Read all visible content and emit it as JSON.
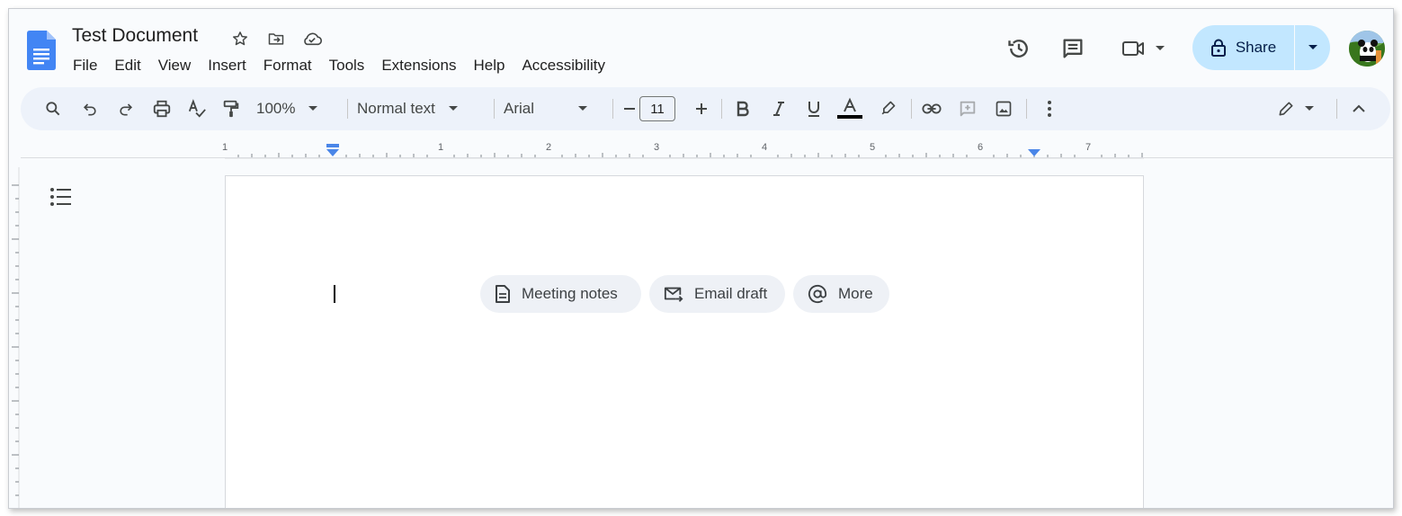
{
  "document": {
    "title": "Test Document"
  },
  "menu": {
    "items": [
      "File",
      "Edit",
      "View",
      "Insert",
      "Format",
      "Tools",
      "Extensions",
      "Help",
      "Accessibility"
    ]
  },
  "header": {
    "share_label": "Share"
  },
  "toolbar": {
    "zoom": "100%",
    "style": "Normal text",
    "font": "Arial",
    "font_size": "11",
    "text_color": "#000000"
  },
  "ruler": {
    "labels": [
      "1",
      "1",
      "2",
      "3",
      "4",
      "5",
      "6",
      "7"
    ]
  },
  "chips": {
    "meeting_notes": "Meeting notes",
    "email_draft": "Email draft",
    "more": "More"
  },
  "icons": {
    "doc": "google-docs-icon",
    "star": "star-icon",
    "move": "move-to-folder-icon",
    "cloud": "cloud-saved-icon",
    "history": "version-history-icon",
    "comments": "comments-icon",
    "meet": "video-call-icon",
    "lock": "lock-icon"
  },
  "colors": {
    "accent": "#c2e7ff",
    "toolbar_bg": "#edf2fa",
    "docs_blue": "#4285f4",
    "ruler_marker": "#4a86e8"
  }
}
